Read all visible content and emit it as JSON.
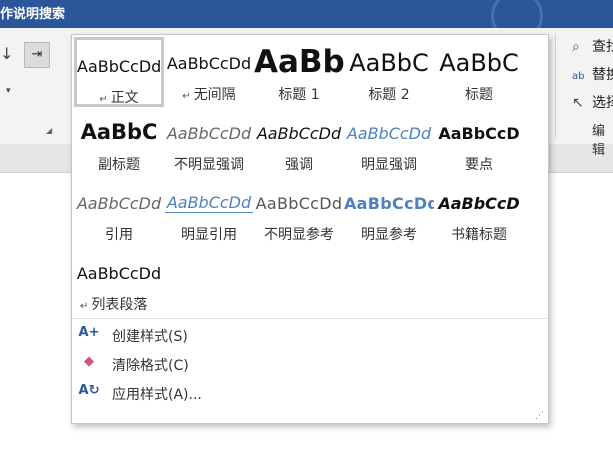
{
  "app": {
    "title_fragment": "作说明搜索",
    "titlebar_color": "#2b579a"
  },
  "ribbon": {
    "left_arrow": "↓",
    "left_dropdown": "▾",
    "indent_icon": "⇥",
    "editing": {
      "find_label": "查找",
      "replace_label": "替换",
      "select_label": "选择",
      "group_label": "编辑"
    }
  },
  "styles_gallery": {
    "tiles": [
      {
        "sample": "AaBbCcDd",
        "name": "正文",
        "paragraph_mark": "↵",
        "selected": true,
        "variant": "normal"
      },
      {
        "sample": "AaBbCcDd",
        "name": "无间隔",
        "paragraph_mark": "↵",
        "selected": false,
        "variant": "normal"
      },
      {
        "sample": "AaBb",
        "name": "标题 1",
        "selected": false,
        "variant": "h1"
      },
      {
        "sample": "AaBbC",
        "name": "标题 2",
        "selected": false,
        "variant": "h2"
      },
      {
        "sample": "AaBbC",
        "name": "标题",
        "selected": false,
        "variant": "title"
      },
      {
        "sample": "AaBbC",
        "name": "副标题",
        "selected": false,
        "variant": "subtitle"
      },
      {
        "sample": "AaBbCcDd",
        "name": "不明显强调",
        "selected": false,
        "variant": "italic-gray"
      },
      {
        "sample": "AaBbCcDd",
        "name": "强调",
        "selected": false,
        "variant": "italic"
      },
      {
        "sample": "AaBbCcDd",
        "name": "明显强调",
        "selected": false,
        "variant": "italic-blue"
      },
      {
        "sample": "AaBbCcD",
        "name": "要点",
        "selected": false,
        "variant": "bold"
      },
      {
        "sample": "AaBbCcDd",
        "name": "引用",
        "selected": false,
        "variant": "italic-gray"
      },
      {
        "sample": "AaBbCcDd",
        "name": "明显引用",
        "selected": false,
        "variant": "quote-intense"
      },
      {
        "sample": "AaBbCcDd",
        "name": "不明显参考",
        "selected": false,
        "variant": "ref"
      },
      {
        "sample": "AaBbCcDd",
        "name": "明显参考",
        "selected": false,
        "variant": "ref-intense"
      },
      {
        "sample": "AaBbCcD",
        "name": "书籍标题",
        "selected": false,
        "variant": "book"
      },
      {
        "sample": "AaBbCcDd",
        "name": "列表段落",
        "paragraph_mark": "↵",
        "selected": false,
        "variant": "normal"
      }
    ],
    "menu": [
      {
        "label": "创建样式(S)",
        "icon": "create-style-icon"
      },
      {
        "label": "清除格式(C)",
        "icon": "clear-formatting-icon"
      },
      {
        "label": "应用样式(A)...",
        "icon": "apply-styles-icon"
      }
    ],
    "accent_color": "#4f81bd"
  }
}
